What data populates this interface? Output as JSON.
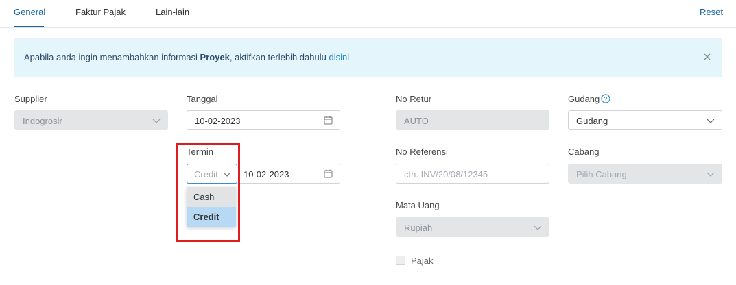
{
  "tabs": [
    "General",
    "Faktur Pajak",
    "Lain-lain"
  ],
  "reset_label": "Reset",
  "alert": {
    "text_before": "Apabila anda ingin menambahkan informasi ",
    "bold": "Proyek",
    "text_middle": ", aktifkan terlebih dahulu ",
    "link": "disini"
  },
  "form": {
    "supplier": {
      "label": "Supplier",
      "value": "Indogrosir"
    },
    "tanggal": {
      "label": "Tanggal",
      "value": "10-02-2023"
    },
    "termin": {
      "label": "Termin",
      "placeholder": "Credit",
      "date": "10-02-2023",
      "options": [
        "Cash",
        "Credit"
      ],
      "selected": "Credit"
    },
    "no_retur": {
      "label": "No Retur",
      "value": "AUTO"
    },
    "no_referensi": {
      "label": "No Referensi",
      "placeholder": "cth. INV/20/08/12345"
    },
    "mata_uang": {
      "label": "Mata Uang",
      "value": "Rupiah"
    },
    "pajak": {
      "label": "Pajak"
    },
    "gudang": {
      "label": "Gudang",
      "value": "Gudang"
    },
    "cabang": {
      "label": "Cabang",
      "placeholder": "Pilih Cabang"
    }
  },
  "colors": {
    "accent": "#1565a6",
    "alert_bg": "#e5f5fc",
    "highlight": "#e01d1d",
    "selected_option": "#b7d9f4"
  }
}
